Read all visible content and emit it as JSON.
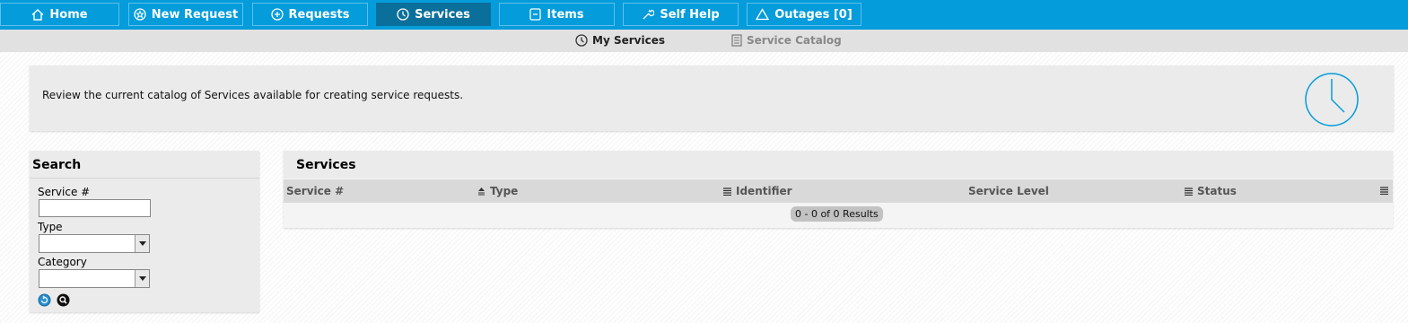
{
  "nav": {
    "tabs": [
      {
        "label": "Home",
        "icon": "home-icon"
      },
      {
        "label": "New Request",
        "icon": "star-circle-icon"
      },
      {
        "label": "Requests",
        "icon": "plus-circle-icon"
      },
      {
        "label": "Services",
        "icon": "clock-icon",
        "active": true
      },
      {
        "label": "Items",
        "icon": "minus-box-icon"
      },
      {
        "label": "Self Help",
        "icon": "wrench-icon"
      },
      {
        "label": "Outages [0]",
        "icon": "warning-triangle-icon"
      }
    ]
  },
  "subnav": {
    "items": [
      {
        "label": "My Services",
        "icon": "clock-icon",
        "active": true
      },
      {
        "label": "Service Catalog",
        "icon": "catalog-icon",
        "active": false
      }
    ]
  },
  "info": {
    "message": "Review the current catalog of Services available for creating service requests.",
    "icon": "clock-icon"
  },
  "search": {
    "title": "Search",
    "service_label": "Service #",
    "service_value": "",
    "type_label": "Type",
    "type_value": "",
    "category_label": "Category",
    "category_value": "",
    "reset_icon": "reset-icon",
    "search_icon": "magnifier-icon"
  },
  "services": {
    "title": "Services",
    "columns": [
      {
        "label": "Service #",
        "icon": ""
      },
      {
        "label": "Type",
        "icon": "sort-asc-icon"
      },
      {
        "label": "Identifier",
        "icon": "column-menu-icon"
      },
      {
        "label": "Service Level",
        "icon": ""
      },
      {
        "label": "Status",
        "icon": "column-menu-icon"
      }
    ],
    "results_text": "0 - 0 of 0 Results"
  },
  "colors": {
    "topbar": "#049cdb",
    "active_tab": "#0b6f9b",
    "panel": "#ebebeb",
    "subbar": "#e1e1e1"
  }
}
